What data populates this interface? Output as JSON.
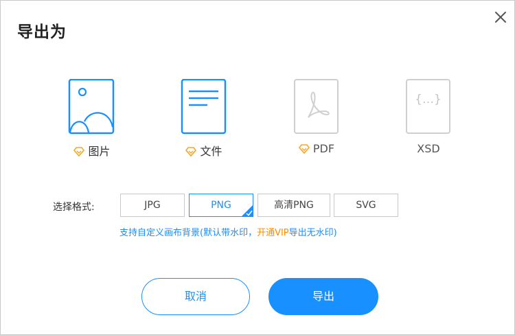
{
  "dialog": {
    "title": "导出为",
    "close_icon": "close-icon"
  },
  "options": [
    {
      "label": "图片",
      "icon": "image-file-icon",
      "vip": true,
      "enabled": true
    },
    {
      "label": "文件",
      "icon": "text-file-icon",
      "vip": true,
      "enabled": true
    },
    {
      "label": "PDF",
      "icon": "pdf-file-icon",
      "vip": true,
      "enabled": false
    },
    {
      "label": "XSD",
      "icon": "xsd-file-icon",
      "vip": false,
      "enabled": false
    }
  ],
  "format": {
    "label": "选择格式:",
    "choices": [
      "JPG",
      "PNG",
      "高清PNG",
      "SVG"
    ],
    "selected": "PNG"
  },
  "hint": {
    "part1": "支持自定义画布背景(默认带水印，",
    "part2": "开通VIP",
    "part3": "导出无水印)"
  },
  "buttons": {
    "cancel": "取消",
    "export": "导出"
  },
  "colors": {
    "accent": "#1890ff",
    "vip": "#f5a623",
    "promo": "#ff8a00",
    "disabled": "#c8c8c8"
  }
}
